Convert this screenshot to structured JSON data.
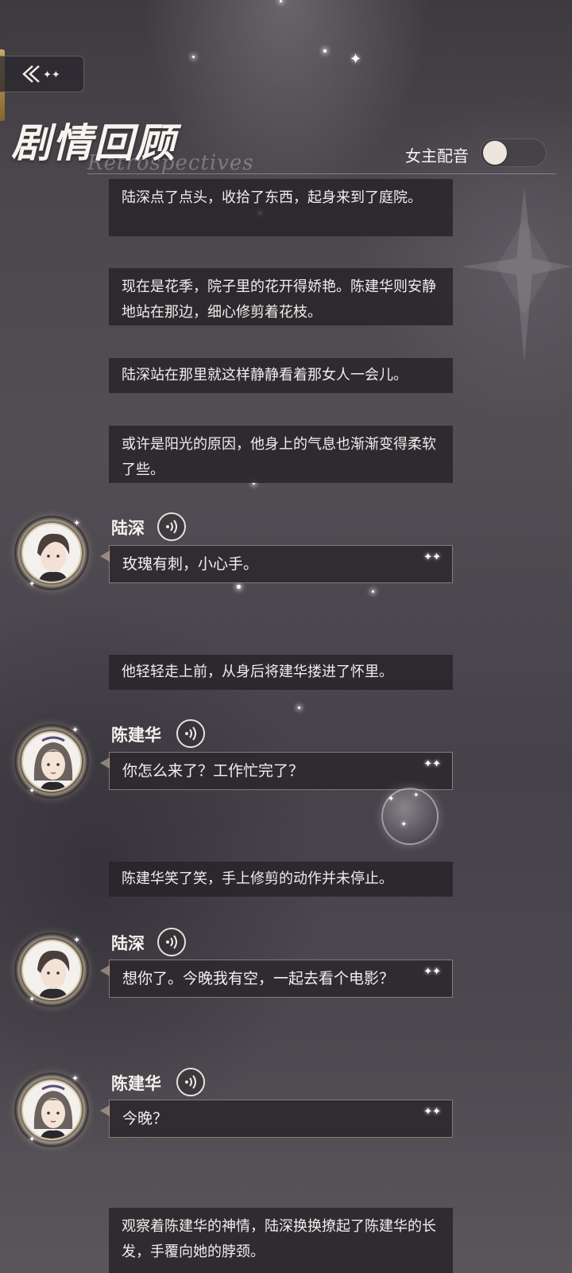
{
  "header": {
    "title": "剧情回顾",
    "subtitle": "Retrospectives",
    "voice_toggle_label": "女主配音"
  },
  "entries": [
    {
      "type": "narration",
      "text": "陆深点了点头，收拾了东西，起身来到了庭院。"
    },
    {
      "type": "narration",
      "text": "现在是花季，院子里的花开得娇艳。陈建华则安静地站在那边，细心修剪着花枝。"
    },
    {
      "type": "narration",
      "text": "陆深站在那里就这样静静看着那女人一会儿。"
    },
    {
      "type": "narration",
      "text": "或许是阳光的原因，他身上的气息也渐渐变得柔软了些。"
    },
    {
      "type": "dialogue",
      "speaker": "陆深",
      "text": "玫瑰有刺，小心手。"
    },
    {
      "type": "narration",
      "text": "他轻轻走上前，从身后将建华搂进了怀里。"
    },
    {
      "type": "dialogue",
      "speaker": "陈建华",
      "text": "你怎么来了？工作忙完了？"
    },
    {
      "type": "narration",
      "text": "陈建华笑了笑，手上修剪的动作并未停止。"
    },
    {
      "type": "dialogue",
      "speaker": "陆深",
      "text": "想你了。今晚我有空，一起去看个电影？"
    },
    {
      "type": "dialogue",
      "speaker": "陈建华",
      "text": "今晚？"
    },
    {
      "type": "narration",
      "text": "观察着陈建华的神情，陆深换换撩起了陈建华的长发，手覆向她的脖颈。"
    }
  ],
  "icons": {
    "back": "back-arrow-icon",
    "audio": "sound-wave-icon",
    "sparkle": "sparkle-icon"
  },
  "colors": {
    "accent_gold": "#d8b36a",
    "panel_bg": "#26232a",
    "bubble_border": "#d2beaa"
  }
}
